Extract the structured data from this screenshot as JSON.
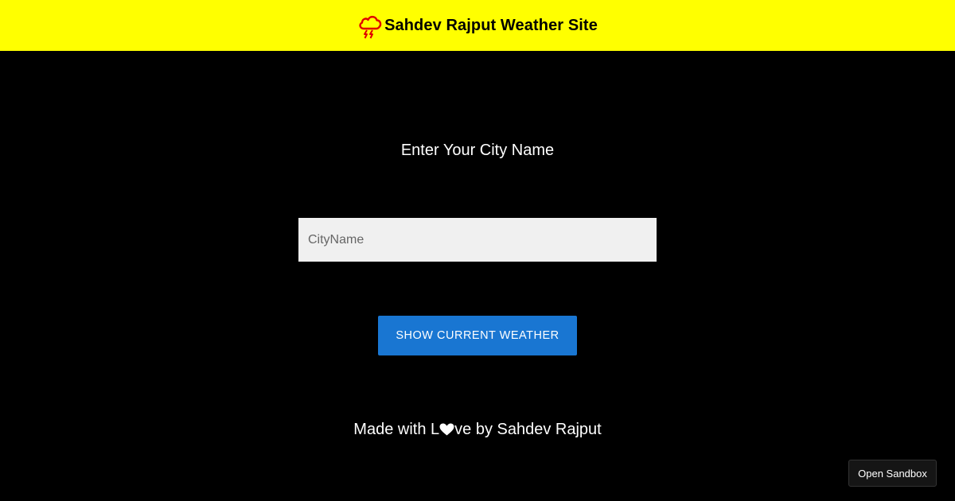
{
  "header": {
    "icon": "thunderstorm-cloud-icon",
    "title": "Sahdev Rajput Weather Site",
    "background_color": "#ffff00"
  },
  "main": {
    "prompt": "Enter Your City Name",
    "city_input": {
      "value": "",
      "placeholder": "CityName"
    },
    "show_button_label": "SHOW CURRENT WEATHER",
    "button_color": "#1976d2"
  },
  "footer": {
    "text_before": "Made with L",
    "heart_icon": "heart-icon",
    "text_after": "ve by Sahdev Rajput"
  },
  "sandbox": {
    "label": "Open Sandbox"
  }
}
